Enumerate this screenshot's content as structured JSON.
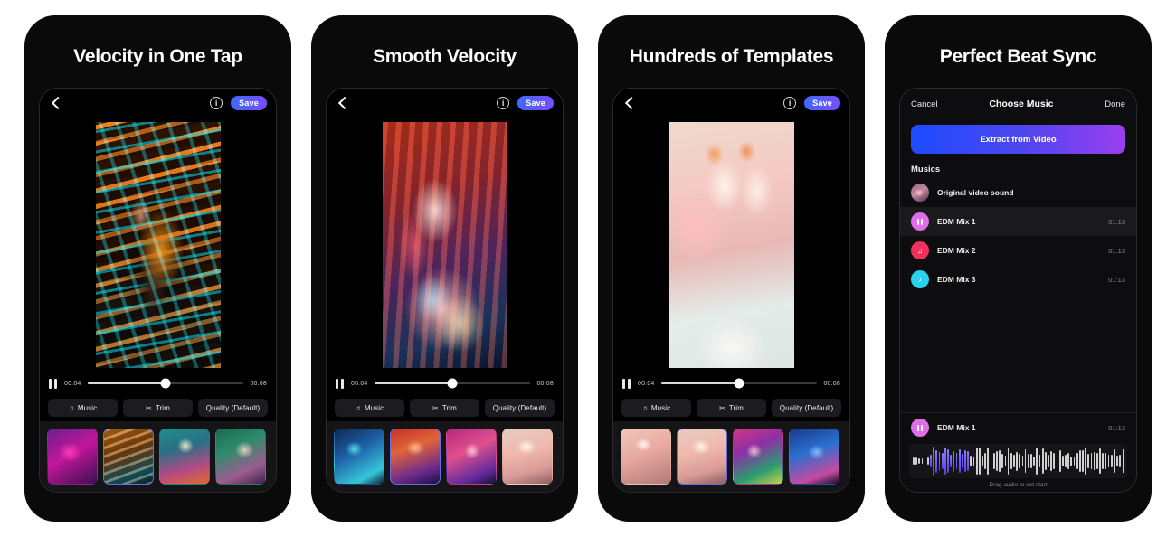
{
  "phones": [
    {
      "title": "Velocity in One Tap",
      "type": "editor",
      "topbar": {
        "back_icon": "chevron-left-icon",
        "info_icon": "info-circle-icon",
        "save_label": "Save"
      },
      "player": {
        "pause_icon": "pause-icon",
        "current_time": "00:04",
        "total_time": "00:08",
        "progress_pct": 50
      },
      "tools": [
        {
          "icon": "music-note-icon",
          "glyph": "♫",
          "label": "Music"
        },
        {
          "icon": "scissors-icon",
          "glyph": "✂",
          "label": "Trim"
        },
        {
          "icon": "",
          "glyph": "",
          "label": "Quality (Default)"
        }
      ],
      "templates": [
        {
          "name": "template-thumb-1",
          "style": "th-a",
          "selected": false
        },
        {
          "name": "template-thumb-2",
          "style": "th-b",
          "selected": true
        },
        {
          "name": "template-thumb-3",
          "style": "th-c",
          "selected": false
        },
        {
          "name": "template-thumb-4",
          "style": "th-d",
          "selected": false
        }
      ],
      "video_style": "v1"
    },
    {
      "title": "Smooth Velocity",
      "type": "editor",
      "topbar": {
        "back_icon": "chevron-left-icon",
        "info_icon": "info-circle-icon",
        "save_label": "Save"
      },
      "player": {
        "pause_icon": "pause-icon",
        "current_time": "00:04",
        "total_time": "00:08",
        "progress_pct": 50
      },
      "tools": [
        {
          "icon": "music-note-icon",
          "glyph": "♫",
          "label": "Music"
        },
        {
          "icon": "scissors-icon",
          "glyph": "✂",
          "label": "Trim"
        },
        {
          "icon": "",
          "glyph": "",
          "label": "Quality (Default)"
        }
      ],
      "templates": [
        {
          "name": "template-thumb-1",
          "style": "th-e",
          "selected": false
        },
        {
          "name": "template-thumb-2",
          "style": "th-f",
          "selected": true
        },
        {
          "name": "template-thumb-3",
          "style": "th-g",
          "selected": false
        },
        {
          "name": "template-thumb-4",
          "style": "th-h",
          "selected": false
        }
      ],
      "video_style": "v2"
    },
    {
      "title": "Hundreds of Templates",
      "type": "editor",
      "topbar": {
        "back_icon": "chevron-left-icon",
        "info_icon": "info-circle-icon",
        "save_label": "Save"
      },
      "player": {
        "pause_icon": "pause-icon",
        "current_time": "00:04",
        "total_time": "00:08",
        "progress_pct": 50
      },
      "tools": [
        {
          "icon": "music-note-icon",
          "glyph": "♫",
          "label": "Music"
        },
        {
          "icon": "scissors-icon",
          "glyph": "✂",
          "label": "Trim"
        },
        {
          "icon": "",
          "glyph": "",
          "label": "Quality (Default)"
        }
      ],
      "templates": [
        {
          "name": "template-thumb-1",
          "style": "th-i",
          "selected": false
        },
        {
          "name": "template-thumb-2",
          "style": "th-h",
          "selected": true
        },
        {
          "name": "template-thumb-3",
          "style": "th-j",
          "selected": false
        },
        {
          "name": "template-thumb-4",
          "style": "th-k",
          "selected": false
        }
      ],
      "video_style": "v3"
    },
    {
      "title": "Perfect Beat Sync",
      "type": "music",
      "music_panel": {
        "cancel_label": "Cancel",
        "header_title": "Choose Music",
        "done_label": "Done",
        "extract_label": "Extract from Video",
        "section_label": "Musics",
        "tracks": [
          {
            "name": "Original video sound",
            "duration": "",
            "icon": "album-thumbnail-icon",
            "avatar_class": "mav-photo",
            "avatar_color": "#c98aa0",
            "glyph": "",
            "active": false
          },
          {
            "name": "EDM Mix 1",
            "duration": "01:13",
            "icon": "pause-icon",
            "avatar_class": "",
            "avatar_color": "#e06ee8",
            "glyph": "pause",
            "active": true
          },
          {
            "name": "EDM Mix 2",
            "duration": "01:13",
            "icon": "music-note-icon",
            "avatar_class": "",
            "avatar_color": "#f0315e",
            "glyph": "♫",
            "active": false
          },
          {
            "name": "EDM Mix 3",
            "duration": "01:13",
            "icon": "music-note-icon",
            "avatar_class": "",
            "avatar_color": "#2ad2ef",
            "glyph": "♪",
            "active": false
          }
        ],
        "selected_track": {
          "name": "EDM Mix 1",
          "duration": "01:13",
          "icon": "pause-icon",
          "avatar_color": "#e06ee8"
        },
        "drag_hint": "Drag audio to set start"
      }
    }
  ],
  "colors": {
    "background": "#ffffff",
    "phone_body": "#0a0a0a",
    "screen": "#000000",
    "accent_blue": "#3d6bff",
    "accent_purple": "#7a4bff",
    "selected_border": "#6c6ce0",
    "waveform_highlight": "#5b3ff0"
  }
}
